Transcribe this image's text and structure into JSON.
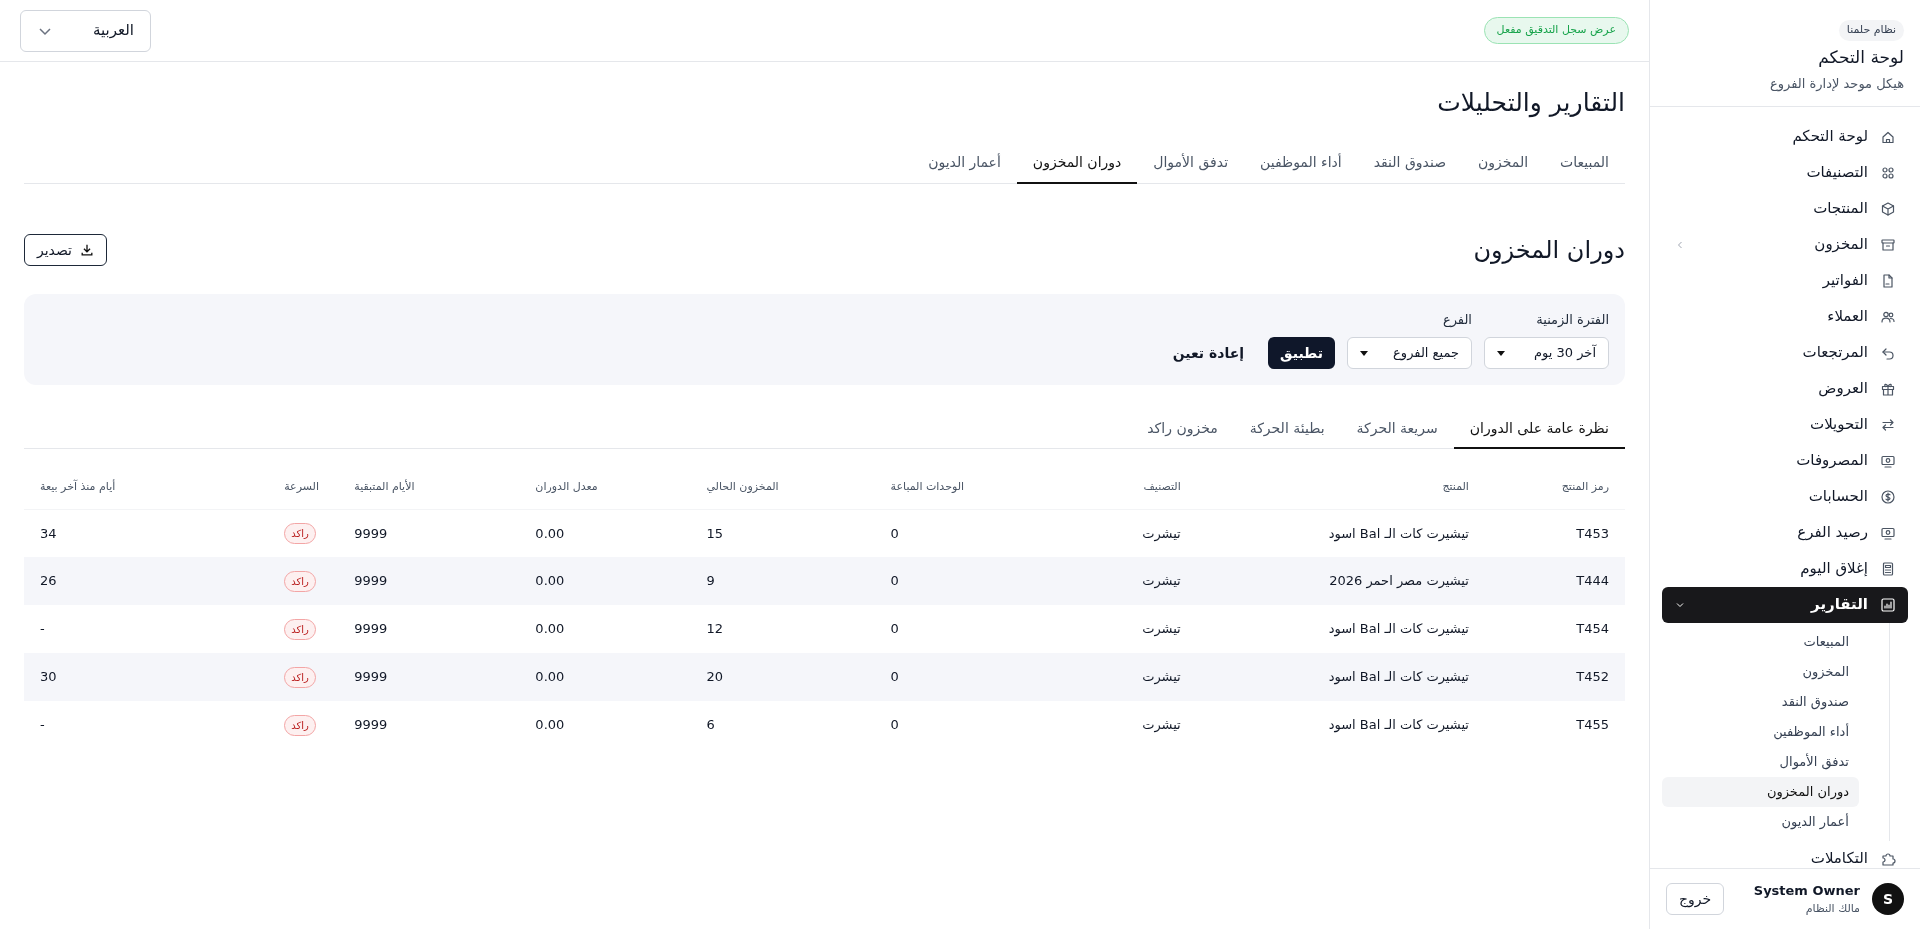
{
  "sidebar": {
    "badge": "نظام حلمنا",
    "title": "لوحة التحكم",
    "subtitle": "هيكل موحد لإدارة الفروع",
    "items": [
      {
        "label": "لوحة التحكم",
        "selected": false
      },
      {
        "label": "التصنيفات",
        "selected": false
      },
      {
        "label": "المنتجات",
        "selected": false
      },
      {
        "label": "المخزون",
        "selected": false,
        "expanded": false
      },
      {
        "label": "الفواتير",
        "selected": false
      },
      {
        "label": "العملاء",
        "selected": false
      },
      {
        "label": "المرتجعات",
        "selected": false
      },
      {
        "label": "العروض",
        "selected": false
      },
      {
        "label": "التحويلات",
        "selected": false
      },
      {
        "label": "المصروفات",
        "selected": false
      },
      {
        "label": "الحسابات",
        "selected": false
      },
      {
        "label": "رصيد الفرع",
        "selected": false
      },
      {
        "label": "إغلاق اليوم",
        "selected": false
      },
      {
        "label": "التقارير",
        "selected": true,
        "expanded": true,
        "children": [
          {
            "label": "المبيعات",
            "selected": false
          },
          {
            "label": "المخزون",
            "selected": false
          },
          {
            "label": "صندوق النقد",
            "selected": false
          },
          {
            "label": "أداء الموظفين",
            "selected": false
          },
          {
            "label": "تدفق الأموال",
            "selected": false
          },
          {
            "label": "دوران المخزون",
            "selected": true
          },
          {
            "label": "أعمار الديون",
            "selected": false
          }
        ]
      },
      {
        "label": "التكاملات",
        "selected": false
      }
    ],
    "user": {
      "initial": "S",
      "name": "System Owner",
      "role": "مالك النظام",
      "logout": "خروج"
    }
  },
  "topbar": {
    "audit_badge": "عرض سجل التدقيق مفعل",
    "language": "العربية"
  },
  "page_title": "التقارير والتحليلات",
  "tabs": [
    {
      "label": "المبيعات",
      "selected": false
    },
    {
      "label": "المخزون",
      "selected": false
    },
    {
      "label": "صندوق النقد",
      "selected": false
    },
    {
      "label": "أداء الموظفين",
      "selected": false
    },
    {
      "label": "تدفق الأموال",
      "selected": false
    },
    {
      "label": "دوران المخزون",
      "selected": true
    },
    {
      "label": "أعمار الديون",
      "selected": false
    }
  ],
  "section": {
    "title": "دوران المخزون",
    "export": "تصدير"
  },
  "filters": {
    "fields": [
      {
        "label": "الفترة الزمنية",
        "value": "آخر 30 يوم"
      },
      {
        "label": "الفرع",
        "value": "جميع الفروع"
      }
    ],
    "apply": "تطبيق",
    "reset": "إعادة تعين"
  },
  "subtabs": [
    {
      "label": "نظرة عامة على الدوران",
      "selected": true
    },
    {
      "label": "سريعة الحركة",
      "selected": false
    },
    {
      "label": "بطيئة الحركة",
      "selected": false
    },
    {
      "label": "مخزون راكد",
      "selected": false
    }
  ],
  "table": {
    "columns": [
      "رمز المنتج",
      "المنتج",
      "التصنيف",
      "الوحدات المباعة",
      "المخزون الحالي",
      "معدل الدوران",
      "الأيام المتبقية",
      "السرعة",
      "أيام منذ آخر بيعة"
    ],
    "rows": [
      [
        "T453",
        "تيشيرت كات الـ Bal اسود",
        "تيشرت",
        "0",
        "15",
        "0.00",
        "9999",
        "راكد",
        "34"
      ],
      [
        "T444",
        "تيشيرت مصر احمر 2026",
        "تيشرت",
        "0",
        "9",
        "0.00",
        "9999",
        "راكد",
        "26"
      ],
      [
        "T454",
        "تيشيرت كات الـ Bal اسود",
        "تيشرت",
        "0",
        "12",
        "0.00",
        "9999",
        "راكد",
        "-"
      ],
      [
        "T452",
        "تيشيرت كات الـ Bal اسود",
        "تيشرت",
        "0",
        "20",
        "0.00",
        "9999",
        "راكد",
        "30"
      ],
      [
        "T455",
        "تيشيرت كات الـ Bal اسود",
        "تيشرت",
        "0",
        "6",
        "0.00",
        "9999",
        "راكد",
        "-"
      ]
    ]
  }
}
